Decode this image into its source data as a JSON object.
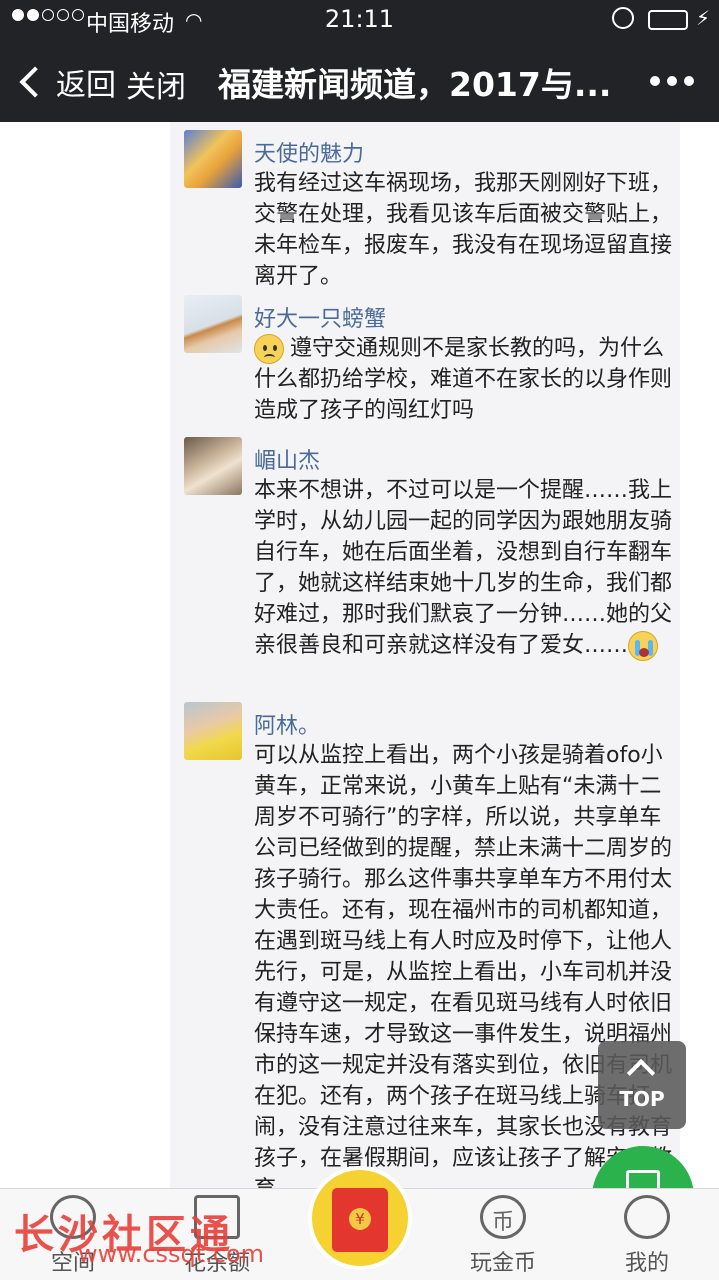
{
  "status": {
    "carrier": "中国移动",
    "time": "21:11"
  },
  "nav": {
    "back_label": "返回",
    "close_label": "关闭",
    "title": "福建新闻频道，2017与..."
  },
  "comments": [
    {
      "name": "天使的魅力",
      "text": "我有经过这车祸现场，我那天刚刚好下班，交警在处理，我看见该车后面被交警贴上，未年检车，报废车，我没有在现场逗留直接离开了。"
    },
    {
      "name": "好大一只螃蟹",
      "text": "遵守交通规则不是家长教的吗，为什么什么都扔给学校，难道不在家长的以身作则造成了孩子的闯红灯吗"
    },
    {
      "name": "嵋山杰",
      "text": "本来不想讲，不过可以是一个提醒……我上学时，从幼儿园一起的同学因为跟她朋友骑自行车，她在后面坐着，没想到自行车翻车了，她就这样结束她十几岁的生命，我们都好难过，那时我们默哀了一分钟……她的父亲很善良和可亲就这样没有了爱女……"
    },
    {
      "name": "阿林。",
      "text": "可以从监控上看出，两个小孩是骑着ofo小黄车，正常来说，小黄车上贴有“未满十二周岁不可骑行”的字样，所以说，共享单车公司已经做到的提醒，禁止未满十二周岁的孩子骑行。那么这件事共享单车方不用付太大责任。还有，现在福州市的司机都知道，在遇到斑马线上有人时应及时停下，让他人先行，可是，从监控上看出，小车司机并没有遵守这一规定，在看见斑马线有人时依旧保持车速，才导致这一事件发生，说明福州市的这一规定并没有落实到位，依旧有司机在犯。还有，两个孩子在斑马线上骑车打闹，没有注意过往来车，其家长也没有教育孩子，在暑假期间，应该让孩子了解安全教育。"
    }
  ],
  "top_button": "TOP",
  "tabs": [
    {
      "label": "空间",
      "icon": "chat-bubble-icon"
    },
    {
      "label": "花余额",
      "icon": "wallet-icon"
    },
    {
      "label": "",
      "icon": "red-envelope-icon"
    },
    {
      "label": "玩金币",
      "icon": "coin-icon"
    },
    {
      "label": "我的",
      "icon": "person-icon"
    }
  ],
  "watermark": {
    "brand": "长沙社区通",
    "url": "www.cssqt.com"
  },
  "colors": {
    "bar": "#222326",
    "name": "#4a6b98",
    "accent_green": "#2bb24c",
    "watermark": "#e8413a"
  }
}
